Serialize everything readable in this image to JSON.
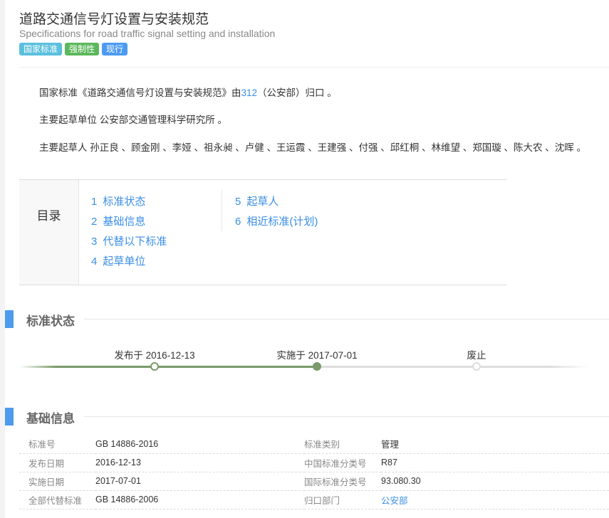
{
  "header": {
    "title": "道路交通信号灯设置与安装规范",
    "subtitle": "Specifications for road traffic signal setting and installation",
    "tags": [
      {
        "label": "国家标准",
        "color": "#5bc0de"
      },
      {
        "label": "强制性",
        "color": "#5cb85c"
      },
      {
        "label": "现行",
        "color": "#4c9bef"
      }
    ]
  },
  "intro": {
    "line1_pre": "国家标准《道路交通信号灯设置与安装规范》由",
    "line1_link": "312",
    "line1_post": "（公安部）归口 。",
    "line2": "主要起草单位 公安部交通管理科学研究所 。",
    "line3": "主要起草人 孙正良 、顾金刚 、李娅 、祖永昶 、卢健 、王运霞 、王建强 、付强 、邱红桐 、林维望 、郑国璇 、陈大农 、沈晖 。"
  },
  "toc": {
    "title": "目录",
    "items": [
      {
        "n": "1",
        "label": "标准状态"
      },
      {
        "n": "2",
        "label": "基础信息"
      },
      {
        "n": "3",
        "label": "代替以下标准"
      },
      {
        "n": "4",
        "label": "起草单位"
      },
      {
        "n": "5",
        "label": "起草人"
      },
      {
        "n": "6",
        "label": "相近标准(计划)"
      }
    ]
  },
  "status": {
    "heading": "标准状态",
    "steps": [
      {
        "label": "发布于 2016-12-13"
      },
      {
        "label": "实施于 2017-07-01"
      },
      {
        "label": "废止"
      }
    ],
    "current_step": 2,
    "colors": {
      "done": "#7a9a6a",
      "pending": "#dddddd"
    }
  },
  "basic": {
    "heading": "基础信息",
    "rows": [
      {
        "k1": "标准号",
        "v1": "GB 14886-2016",
        "k2": "标准类别",
        "v2": "管理"
      },
      {
        "k1": "发布日期",
        "v1": "2016-12-13",
        "k2": "中国标准分类号",
        "v2": "R87"
      },
      {
        "k1": "实施日期",
        "v1": "2017-07-01",
        "k2": "国际标准分类号",
        "v2": "93.080.30"
      },
      {
        "k1": "全部代替标准",
        "v1": "GB 14886-2006",
        "k2": "归口部门",
        "v2": "公安部"
      }
    ]
  }
}
